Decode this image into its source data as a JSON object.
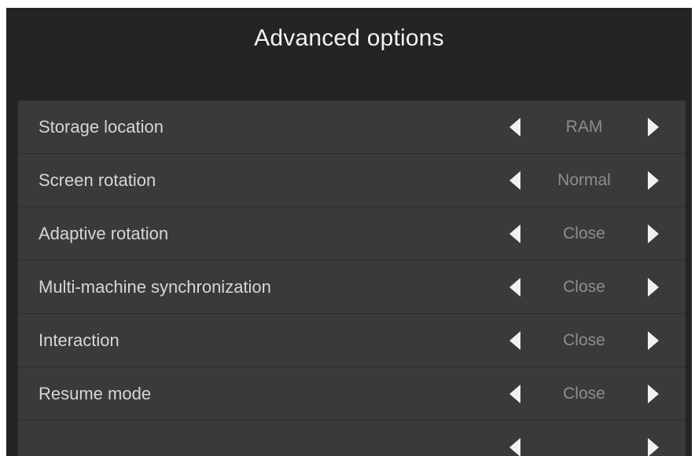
{
  "header": {
    "title": "Advanced options"
  },
  "colors": {
    "background": "#242424",
    "panel": "#3a3a3a",
    "label_text": "#d6d6d6",
    "value_text": "#8e8e8e",
    "arrow": "#f0f0f0"
  },
  "icons": {
    "prev": "triangle-left-icon",
    "next": "triangle-right-icon"
  },
  "settings": [
    {
      "label": "Storage location",
      "value": "RAM"
    },
    {
      "label": "Screen rotation",
      "value": "Normal"
    },
    {
      "label": "Adaptive rotation",
      "value": "Close"
    },
    {
      "label": "Multi-machine synchronization",
      "value": "Close"
    },
    {
      "label": "Interaction",
      "value": "Close"
    },
    {
      "label": "Resume mode",
      "value": "Close"
    },
    {
      "label": "",
      "value": ""
    }
  ]
}
